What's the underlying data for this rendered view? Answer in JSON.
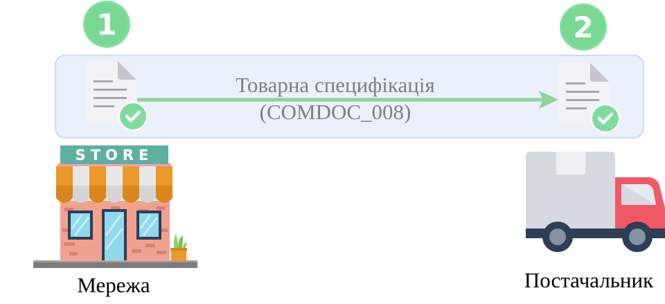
{
  "steps": [
    {
      "number": "1",
      "color": "#7fdc9c"
    },
    {
      "number": "2",
      "color": "#7fdc9c"
    }
  ],
  "flow": {
    "title_line1": "Товарна специфікація",
    "title_line2": "(COMDOC_008)",
    "panel_color": "#eaf1fc",
    "panel_border": "#a9bedc",
    "arrow_color": "#8fd49a",
    "text_color": "#7f7f7f"
  },
  "actors": {
    "sender": {
      "label": "Мережа",
      "icon": "store-icon",
      "sign_text": "STORE"
    },
    "receiver": {
      "label": "Постачальник",
      "icon": "truck-icon"
    }
  },
  "documents": [
    {
      "icon": "approved-document-icon"
    },
    {
      "icon": "approved-document-icon"
    }
  ]
}
